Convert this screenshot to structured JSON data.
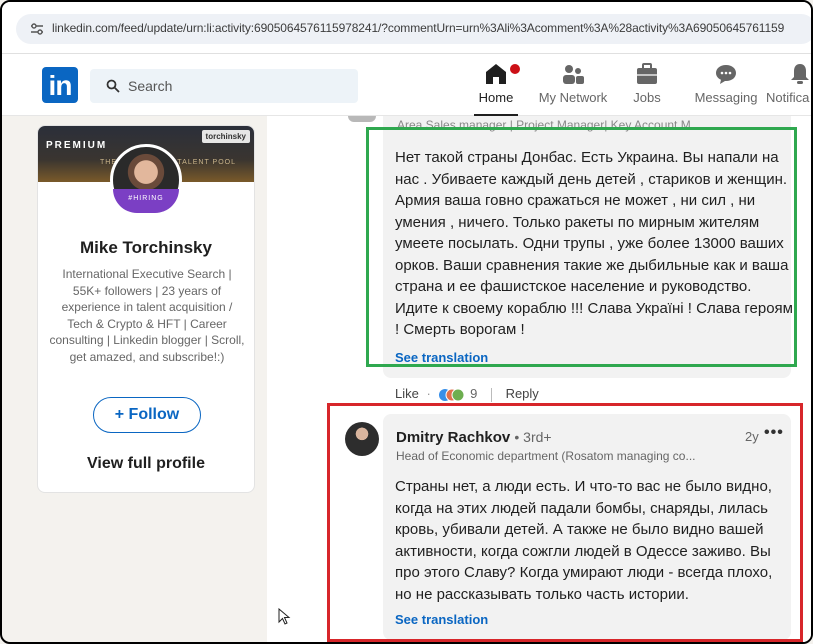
{
  "browser": {
    "url": "linkedin.com/feed/update/urn:li:activity:6905064576115978241/?commentUrn=urn%3Ali%3Acomment%3A%28activity%3A69050645761159"
  },
  "nav": {
    "logo": "in",
    "search_placeholder": "Search",
    "items": [
      {
        "label": "Home",
        "icon": "home-icon",
        "active": true
      },
      {
        "label": "My Network",
        "icon": "network-icon"
      },
      {
        "label": "Jobs",
        "icon": "briefcase-icon"
      },
      {
        "label": "Messaging",
        "icon": "messaging-icon"
      },
      {
        "label": "Notifica",
        "icon": "bell-icon"
      }
    ]
  },
  "profile": {
    "banner_premium": "PREMIUM",
    "banner_brand": "torchinsky",
    "banner_text_left": "THE",
    "banner_text_right": "TALENT POOL",
    "hiring_badge": "#HIRING",
    "name": "Mike Torchinsky",
    "headline": "International Executive Search | 55K+ followers | 23 years of experience in talent acquisition / Tech & Crypto & HFT | Career consulting | Linkedin blogger | Scroll, get amazed, and subscribe!:)",
    "follow_label": "+ Follow",
    "view_profile_label": "View full profile"
  },
  "comment1": {
    "author_headline": "Area Sales manager | Project Manager| Key Account M...",
    "body": "Нет такой страны Донбас. Есть Украина. Вы напали на нас . Убиваете каждый день детей , стариков и женщин. Армия ваша говно сражаться не может , ни сил , ни умения , ничего. Только ракеты по мирным жителям умеете посылать. Одни трупы , уже более 13000 ваших орков. Ваши сравнения такие же дыбильные как и ваша страна и ее фашистское население и руководство. Идите к своему кораблю !!! Слава Україні ! Слава героям ! Смерть ворогам !",
    "see_translation": "See translation",
    "like_label": "Like",
    "separator": "·",
    "reaction_count": "9",
    "reply_label": "Reply"
  },
  "comment2": {
    "author": "Dmitry Rachkov",
    "degree": "• 3rd+",
    "time": "2y",
    "more": "•••",
    "headline": "Head of Economic department (Rosatom managing co...",
    "body": "Страны нет, а люди есть. И что-то вас не было видно, когда на этих людей падали бомбы, снаряды, лилась кровь, убивали детей. А также не было видно вашей активности, когда сожгли людей в Одессе заживо. Вы про этого Славу? Когда умирают люди - всегда плохо, но не рассказывать только часть истории.",
    "see_translation": "See translation"
  },
  "colors": {
    "linkedin_blue": "#0a66c2",
    "highlight_green": "#2fa84f",
    "highlight_red": "#d7262a",
    "notification_red": "#cc1016"
  }
}
